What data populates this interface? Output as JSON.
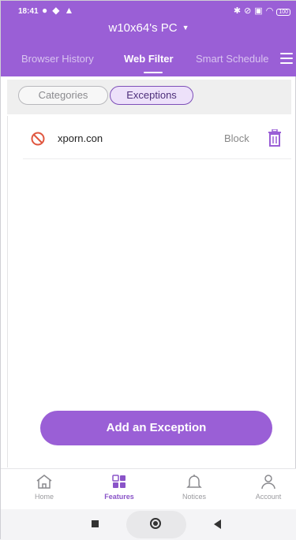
{
  "status_bar": {
    "time": "18:41",
    "battery": "100"
  },
  "device": {
    "name": "w10x64's PC"
  },
  "tabs": [
    {
      "label": "Browser History"
    },
    {
      "label": "Web Filter"
    },
    {
      "label": "Smart Schedule"
    }
  ],
  "segments": {
    "categories": "Categories",
    "exceptions": "Exceptions"
  },
  "exceptions": [
    {
      "domain": "xporn.con",
      "action": "Block"
    }
  ],
  "add_button": {
    "label": "Add an Exception"
  },
  "bottom_nav": [
    {
      "label": "Home",
      "icon": "home-icon"
    },
    {
      "label": "Features",
      "icon": "features-icon"
    },
    {
      "label": "Notices",
      "icon": "bell-icon"
    },
    {
      "label": "Account",
      "icon": "account-icon"
    }
  ],
  "colors": {
    "accent": "#9a5fd6",
    "block_icon": "#e0573f"
  }
}
